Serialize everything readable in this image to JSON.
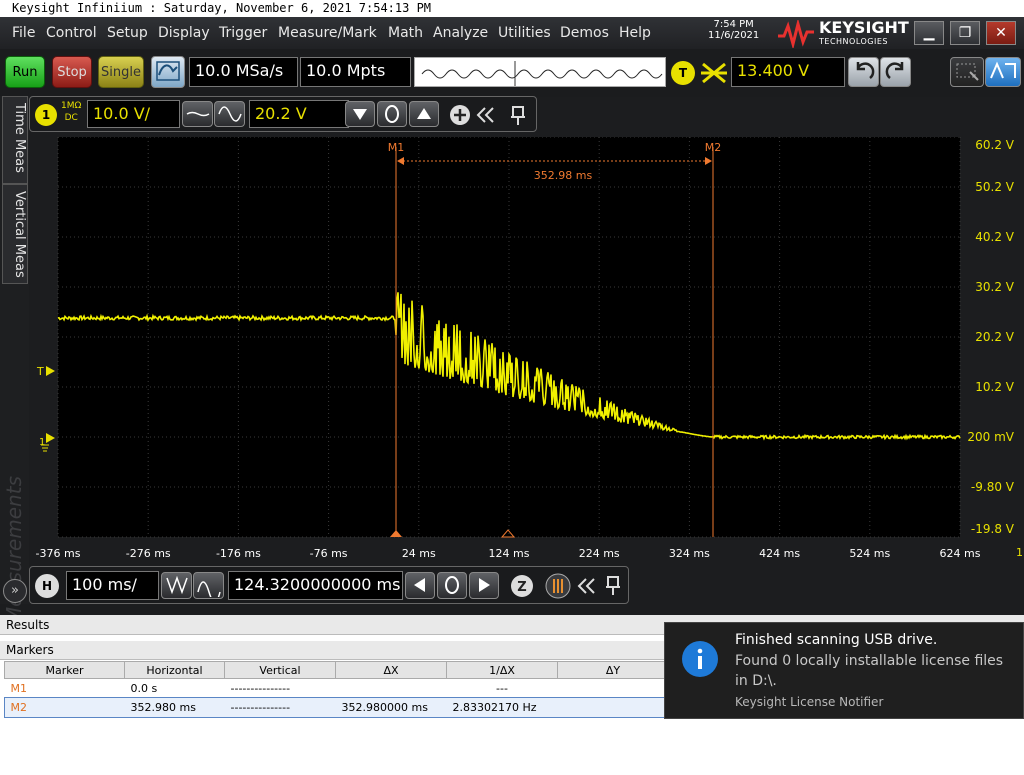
{
  "window": {
    "title": "Keysight Infiniium : Saturday, November 6, 2021 7:54:13 PM"
  },
  "menu": [
    "File",
    "Control",
    "Setup",
    "Display",
    "Trigger",
    "Measure/Mark",
    "Math",
    "Analyze",
    "Utilities",
    "Demos",
    "Help"
  ],
  "clock": {
    "time": "7:54 PM",
    "date": "11/6/2021"
  },
  "brand": {
    "name": "KEYSIGHT",
    "sub": "TECHNOLOGIES"
  },
  "toolbar": {
    "run": "Run",
    "stop": "Stop",
    "single": "Single",
    "sample_rate": "10.0 MSa/s",
    "memory_depth": "10.0 Mpts",
    "trigger_badge": "T",
    "trigger_level": "13.400 V"
  },
  "channel": {
    "badge": "1",
    "coupling_top": "1MΩ",
    "coupling_bottom": "DC",
    "scale": "10.0 V/",
    "offset": "20.2 V"
  },
  "side_tabs": {
    "time_meas": "Time Meas",
    "vertical_meas": "Vertical Meas",
    "watermark": "Measurements"
  },
  "markers_on_scope": {
    "m1": "M1",
    "m2": "M2",
    "delta_label": "352.98 ms"
  },
  "y_axis_labels": [
    "60.2 V",
    "50.2 V",
    "40.2 V",
    "30.2 V",
    "20.2 V",
    "10.2 V",
    "200 mV",
    "-9.80 V",
    "-19.8 V"
  ],
  "x_axis_labels": [
    "-376 ms",
    "-276 ms",
    "-176 ms",
    "-76 ms",
    "24 ms",
    "124 ms",
    "224 ms",
    "324 ms",
    "424 ms",
    "524 ms",
    "624 ms"
  ],
  "x_axis_end_label": "1",
  "left_indicators": {
    "trigger": "T",
    "ground": "1"
  },
  "timebase": {
    "badge": "H",
    "scale": "100 ms/",
    "position": "124.3200000000 ms"
  },
  "results": {
    "tab": "Results",
    "markers_tab": "Markers",
    "columns": [
      "Marker",
      "Horizontal",
      "Vertical",
      "ΔX",
      "1/ΔX",
      "ΔY"
    ],
    "rows": [
      {
        "marker": "M1",
        "horizontal": "0.0 s",
        "vertical": "---------------",
        "dx": "",
        "inv_dx": "---",
        "dy": ""
      },
      {
        "marker": "M2",
        "horizontal": "352.980 ms",
        "vertical": "---------------",
        "dx": "352.980000 ms",
        "inv_dx": "2.83302170 Hz",
        "dy": ""
      }
    ]
  },
  "notification": {
    "icon": "info-icon",
    "title": "Finished scanning USB drive.",
    "body_line1": "Found 0 locally installable license files",
    "body_line2": "in D:\\.",
    "source": "Keysight License Notifier"
  },
  "colors": {
    "trace": "#f0f000",
    "marker": "#f07a30",
    "accent_blue": "#1e7ad8"
  }
}
